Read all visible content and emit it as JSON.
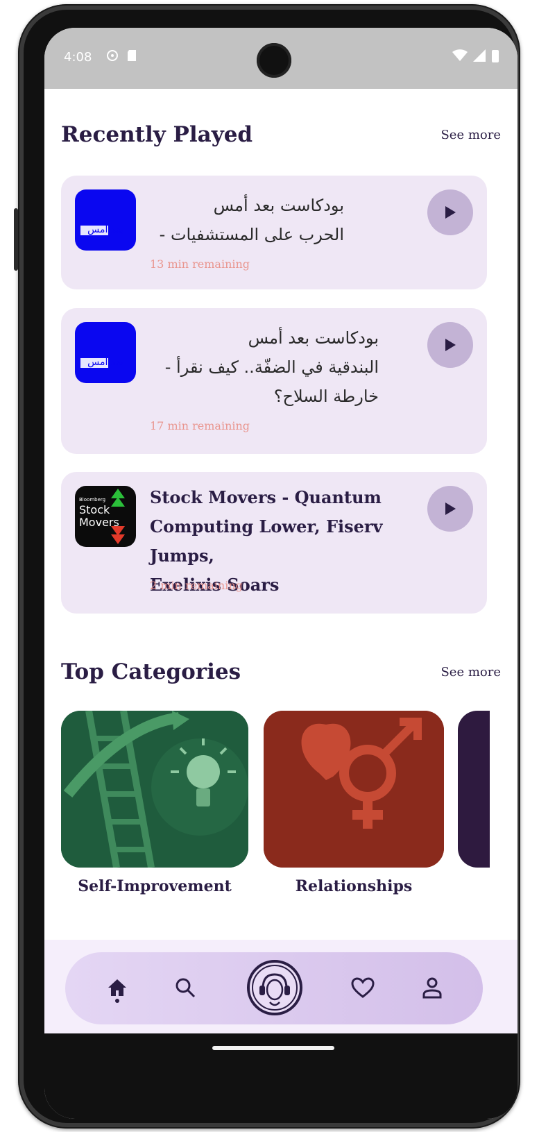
{
  "status_bar": {
    "time": "4:08"
  },
  "recently_played": {
    "title": "Recently Played",
    "see_more": "See more",
    "items": [
      {
        "title_line1": "بودكاست بعد أمس",
        "title_line2": "الحرب على المستشفيات -",
        "title_line3": "",
        "remaining": "13 min remaining",
        "thumb_text": "بعد أمس"
      },
      {
        "title_line1": "بودكاست بعد أمس",
        "title_line2": "البندقية في الضفّة.. كيف نقرأ -",
        "title_line3": "خارطة السلاح؟",
        "remaining": "17 min remaining",
        "thumb_text": "بعد أمس"
      },
      {
        "title_line1": "Stock Movers - Quantum",
        "title_line2": "Computing Lower, Fiserv Jumps,",
        "title_line3": "Exelixis Soars",
        "remaining": "2 min remaining",
        "thumb_small": "Bloomberg",
        "thumb_text1": "Stock",
        "thumb_text2": "Movers"
      }
    ]
  },
  "top_categories": {
    "title": "Top Categories",
    "see_more": "See more",
    "items": [
      {
        "label": "Self-Improvement",
        "color": "#1f5c3d"
      },
      {
        "label": "Relationships",
        "color": "#8a2a1c"
      },
      {
        "label": "",
        "color": "#2e1a3f"
      }
    ]
  },
  "nav": {
    "items": [
      "home-icon",
      "search-icon",
      "avatar-headphones-icon",
      "heart-icon",
      "profile-icon"
    ]
  },
  "colors": {
    "accent_dark": "#2a1d44",
    "card_bg": "#efe7f5",
    "play_bg": "#c3b3d5",
    "remaining": "#e9958e"
  }
}
